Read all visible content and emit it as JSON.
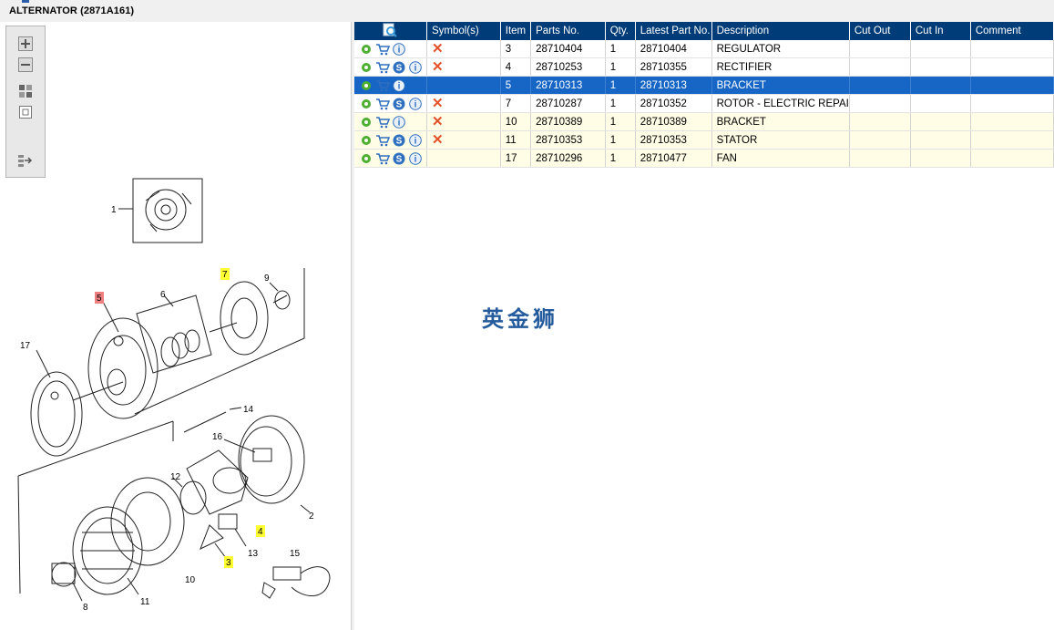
{
  "window": {
    "title": "ALTERNATOR (2871A161)"
  },
  "toolbar": {
    "buttons": [
      {
        "name": "zoom-in",
        "icon": "plus-icon"
      },
      {
        "name": "zoom-out",
        "icon": "minus-icon"
      },
      {
        "name": "fit-all",
        "icon": "grid-icon"
      },
      {
        "name": "actual-size",
        "icon": "square-icon"
      },
      {
        "name": "export",
        "icon": "export-icon"
      }
    ]
  },
  "diagram": {
    "callouts": [
      "1",
      "2",
      "3",
      "4",
      "5",
      "6",
      "7",
      "8",
      "9",
      "10",
      "11",
      "12",
      "13",
      "14",
      "15",
      "16",
      "17"
    ],
    "highlighted_yellow": [
      "3",
      "4",
      "7"
    ],
    "highlighted_red": [
      "5"
    ]
  },
  "table": {
    "columns": [
      "",
      "Symbol(s)",
      "Item",
      "Parts No.",
      "Qty.",
      "Latest Part No.",
      "Description",
      "Cut Out",
      "Cut In",
      "Comment"
    ],
    "rows": [
      {
        "item": "3",
        "part_no": "28710404",
        "qty": "1",
        "latest": "28710404",
        "desc": "REGULATOR",
        "cut_out": "",
        "cut_in": "",
        "comment": "",
        "has_s": false,
        "symbol_x": true,
        "style": "white"
      },
      {
        "item": "4",
        "part_no": "28710253",
        "qty": "1",
        "latest": "28710355",
        "desc": "RECTIFIER",
        "cut_out": "",
        "cut_in": "",
        "comment": "",
        "has_s": true,
        "symbol_x": true,
        "style": "white"
      },
      {
        "item": "5",
        "part_no": "28710313",
        "qty": "1",
        "latest": "28710313",
        "desc": "BRACKET",
        "cut_out": "",
        "cut_in": "",
        "comment": "",
        "has_s": false,
        "symbol_x": false,
        "style": "sel"
      },
      {
        "item": "7",
        "part_no": "28710287",
        "qty": "1",
        "latest": "28710352",
        "desc": "ROTOR - ELECTRIC REPAI",
        "cut_out": "",
        "cut_in": "",
        "comment": "",
        "has_s": true,
        "symbol_x": true,
        "style": "white"
      },
      {
        "item": "10",
        "part_no": "28710389",
        "qty": "1",
        "latest": "28710389",
        "desc": "BRACKET",
        "cut_out": "",
        "cut_in": "",
        "comment": "",
        "has_s": false,
        "symbol_x": true,
        "style": "yellow"
      },
      {
        "item": "11",
        "part_no": "28710353",
        "qty": "1",
        "latest": "28710353",
        "desc": "STATOR",
        "cut_out": "",
        "cut_in": "",
        "comment": "",
        "has_s": true,
        "symbol_x": true,
        "style": "yellow"
      },
      {
        "item": "17",
        "part_no": "28710296",
        "qty": "1",
        "latest": "28710477",
        "desc": "FAN",
        "cut_out": "",
        "cut_in": "",
        "comment": "",
        "has_s": true,
        "symbol_x": false,
        "style": "yellow"
      }
    ]
  },
  "watermark": "英金狮",
  "colors": {
    "header_bg": "#003c78",
    "selected_row": "#1766c6",
    "yellow_row": "#fffde5",
    "x_symbol": "#e2522a",
    "callout_yellow": "#ffff33",
    "callout_red": "#f08080"
  }
}
